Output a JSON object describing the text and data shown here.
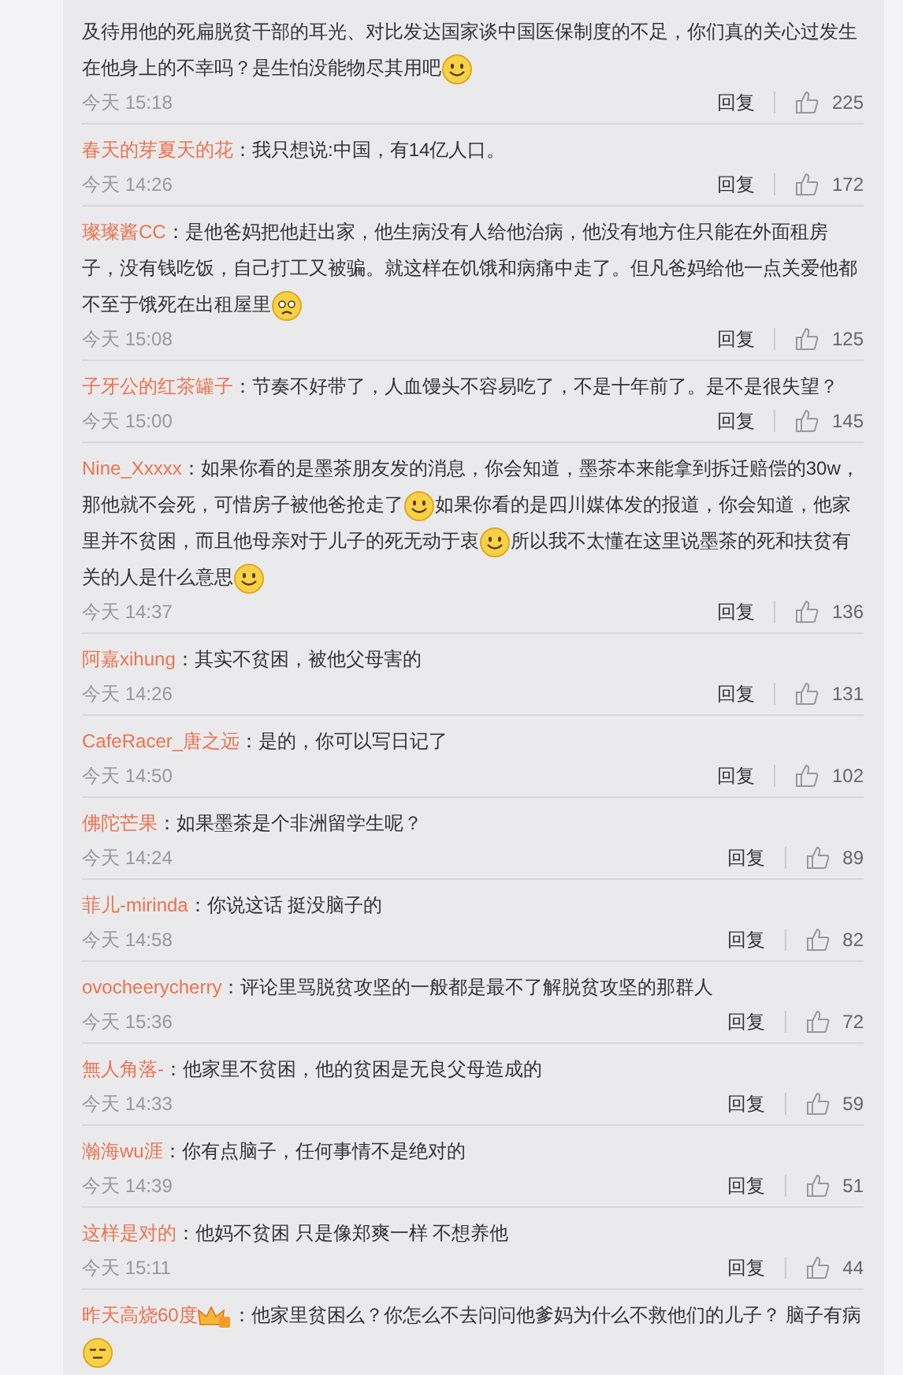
{
  "comments": [
    {
      "lines": [
        [
          {
            "kind": "text",
            "text": "及待用他的死扁脱贫干部的耳光、对比发达国家谈中国医保制度的不足，你们真的关心过发生"
          }
        ],
        [
          {
            "kind": "text",
            "text": "在他身上的不幸吗？是生怕没能物尽其用吧"
          },
          {
            "kind": "smile"
          }
        ]
      ],
      "time": "今天 15:18",
      "reply": "回复",
      "likes": "225"
    },
    {
      "user": "春天的芽夏天的花",
      "lines": [
        [
          {
            "kind": "text",
            "text": "：我只想说:中国，有14亿人口。"
          }
        ]
      ],
      "time": "今天 14:26",
      "reply": "回复",
      "likes": "172"
    },
    {
      "user": "璨璨酱CC",
      "lines": [
        [
          {
            "kind": "text",
            "text": "：是他爸妈把他赶出家，他生病没有人给他治病，他没有地方住只能在外面租房"
          }
        ],
        [
          {
            "kind": "text",
            "text": "子，没有钱吃饭，自己打工又被骗。就这样在饥饿和病痛中走了。但凡爸妈给他一点关爱他都"
          }
        ],
        [
          {
            "kind": "text",
            "text": "不至于饿死在出租屋里"
          },
          {
            "kind": "sad"
          }
        ]
      ],
      "time": "今天 15:08",
      "reply": "回复",
      "likes": "125"
    },
    {
      "user": "子牙公的红茶罐子",
      "lines": [
        [
          {
            "kind": "text",
            "text": "：节奏不好带了，人血馒头不容易吃了，不是十年前了。是不是很失望？"
          }
        ]
      ],
      "time": "今天 15:00",
      "reply": "回复",
      "likes": "145"
    },
    {
      "user": "Nine_Xxxxx",
      "lines": [
        [
          {
            "kind": "text",
            "text": "：如果你看的是墨茶朋友发的消息，你会知道，墨茶本来能拿到拆迁赔偿的30w，"
          }
        ],
        [
          {
            "kind": "text",
            "text": "那他就不会死，可惜房子被他爸抢走了"
          },
          {
            "kind": "smile"
          },
          {
            "kind": "text",
            "text": "如果你看的是四川媒体发的报道，你会知道，他家"
          }
        ],
        [
          {
            "kind": "text",
            "text": "里并不贫困，而且他母亲对于儿子的死无动于衷"
          },
          {
            "kind": "smile"
          },
          {
            "kind": "text",
            "text": "所以我不太懂在这里说墨茶的死和扶贫有"
          }
        ],
        [
          {
            "kind": "text",
            "text": "关的人是什么意思"
          },
          {
            "kind": "smile"
          }
        ]
      ],
      "time": "今天 14:37",
      "reply": "回复",
      "likes": "136"
    },
    {
      "user": "阿嘉xihung",
      "lines": [
        [
          {
            "kind": "text",
            "text": "：其实不贫困，被他父母害的"
          }
        ]
      ],
      "time": "今天 14:26",
      "reply": "回复",
      "likes": "131"
    },
    {
      "user": "CafeRacer_唐之远",
      "lines": [
        [
          {
            "kind": "text",
            "text": "：是的，你可以写日记了"
          }
        ]
      ],
      "time": "今天 14:50",
      "reply": "回复",
      "likes": "102"
    },
    {
      "user": "佛陀芒果",
      "lines": [
        [
          {
            "kind": "text",
            "text": "：如果墨茶是个非洲留学生呢？"
          }
        ]
      ],
      "time": "今天 14:24",
      "reply": "回复",
      "likes": "89"
    },
    {
      "user": "菲儿-mirinda",
      "lines": [
        [
          {
            "kind": "text",
            "text": "：你说这话 挺没脑子的"
          }
        ]
      ],
      "time": "今天 14:58",
      "reply": "回复",
      "likes": "82"
    },
    {
      "user": "ovocheerycherry",
      "lines": [
        [
          {
            "kind": "text",
            "text": "：评论里骂脱贫攻坚的一般都是最不了解脱贫攻坚的那群人"
          }
        ]
      ],
      "time": "今天 15:36",
      "reply": "回复",
      "likes": "72"
    },
    {
      "user": "無人角落-",
      "lines": [
        [
          {
            "kind": "text",
            "text": "：他家里不贫困，他的贫困是无良父母造成的"
          }
        ]
      ],
      "time": "今天 14:33",
      "reply": "回复",
      "likes": "59"
    },
    {
      "user": "瀚海wu涯",
      "lines": [
        [
          {
            "kind": "text",
            "text": "：你有点脑子，任何事情不是绝对的"
          }
        ]
      ],
      "time": "今天 14:39",
      "reply": "回复",
      "likes": "51"
    },
    {
      "user": "这样是对的",
      "lines": [
        [
          {
            "kind": "text",
            "text": "：他妈不贫困 只是像郑爽一样 不想养他"
          }
        ]
      ],
      "time": "今天 15:11",
      "reply": "回复",
      "likes": "44"
    },
    {
      "user": "昨天高烧60度",
      "badge": true,
      "lines": [
        [
          {
            "kind": "text",
            "text": "：他家里贫困么？你怎么不去问问他爹妈为什么不救他们的儿子？ 脑子有病"
          }
        ],
        [
          {
            "kind": "smug"
          }
        ]
      ]
    }
  ]
}
